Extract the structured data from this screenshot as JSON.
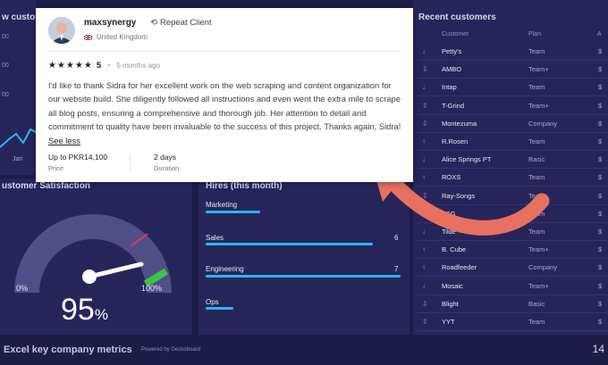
{
  "review": {
    "username": "maxsynergy",
    "badge": "Repeat Client",
    "country": "United Kingdom",
    "rating": "5",
    "time_ago": "5 months ago",
    "text": "I'd like to thank Sidra for her excellent work on the web scraping and content organization for our website build. She diligently followed all instructions and even went the extra mile to scrape all blog posts, ensuring a comprehensive and thorough job. Her attention to detail and commitment to quality have been invaluable to the success of this project. Thanks again, Sidra! ",
    "see_less": "See less",
    "price_value": "Up to PKR14,100",
    "price_label": "Price",
    "duration_value": "2 days",
    "duration_label": "Duration"
  },
  "dashboard": {
    "new_customers_title": "w custo",
    "satisfaction_title": "ustomer Satisfaction",
    "satisfaction_value": "95",
    "satisfaction_unit": "%",
    "gauge_min": "0%",
    "gauge_max": "100%",
    "gauge_level": 0.95,
    "hires_title": "Hires (this month)",
    "hires": [
      {
        "label": "Marketing",
        "value": "",
        "fill": 0.28
      },
      {
        "label": "Sales",
        "value": "6",
        "fill": 0.86
      },
      {
        "label": "Engineering",
        "value": "7",
        "fill": 1.0
      },
      {
        "label": "Ops",
        "value": "",
        "fill": 0.14
      }
    ],
    "recent_title": "Recent customers",
    "recent_headers": [
      "Customer",
      "Plan",
      "A"
    ],
    "recent_rows": [
      {
        "name": "Petty's",
        "plan": "Team",
        "amount": "$"
      },
      {
        "name": "AMBO",
        "plan": "Team+",
        "amount": "$"
      },
      {
        "name": "Intap",
        "plan": "Team",
        "amount": "$"
      },
      {
        "name": "T-Grind",
        "plan": "Team+",
        "amount": "$"
      },
      {
        "name": "Montezuma",
        "plan": "Company",
        "amount": "$"
      },
      {
        "name": "R.Rosen",
        "plan": "Team",
        "amount": "$"
      },
      {
        "name": "Alice Springs PT",
        "plan": "Basic",
        "amount": "$"
      },
      {
        "name": "ROXS",
        "plan": "Team",
        "amount": "$"
      },
      {
        "name": "Ray-Songs",
        "plan": "Team",
        "amount": "$"
      },
      {
        "name": "TSG",
        "plan": "Team",
        "amount": "$"
      },
      {
        "name": "Tilde",
        "plan": "Team",
        "amount": "$"
      },
      {
        "name": "B. Cube",
        "plan": "Team+",
        "amount": "$"
      },
      {
        "name": "Roadfeeder",
        "plan": "Company",
        "amount": "$"
      },
      {
        "name": "Mosaic",
        "plan": "Team+",
        "amount": "$"
      },
      {
        "name": "Blight",
        "plan": "Basic",
        "amount": "$"
      },
      {
        "name": "YYT",
        "plan": "Team",
        "amount": "$"
      }
    ],
    "footer_title": "Excel key company metrics",
    "footer_powered": "Powered by Geckoboard",
    "footer_right": "14"
  },
  "colors": {
    "background": "#1d1c47",
    "panel": "#26255a",
    "bar": "#28b8f0",
    "arrow": "#e8705e",
    "gauge_green": "#3ec24a",
    "gauge_red": "#e0365a"
  }
}
